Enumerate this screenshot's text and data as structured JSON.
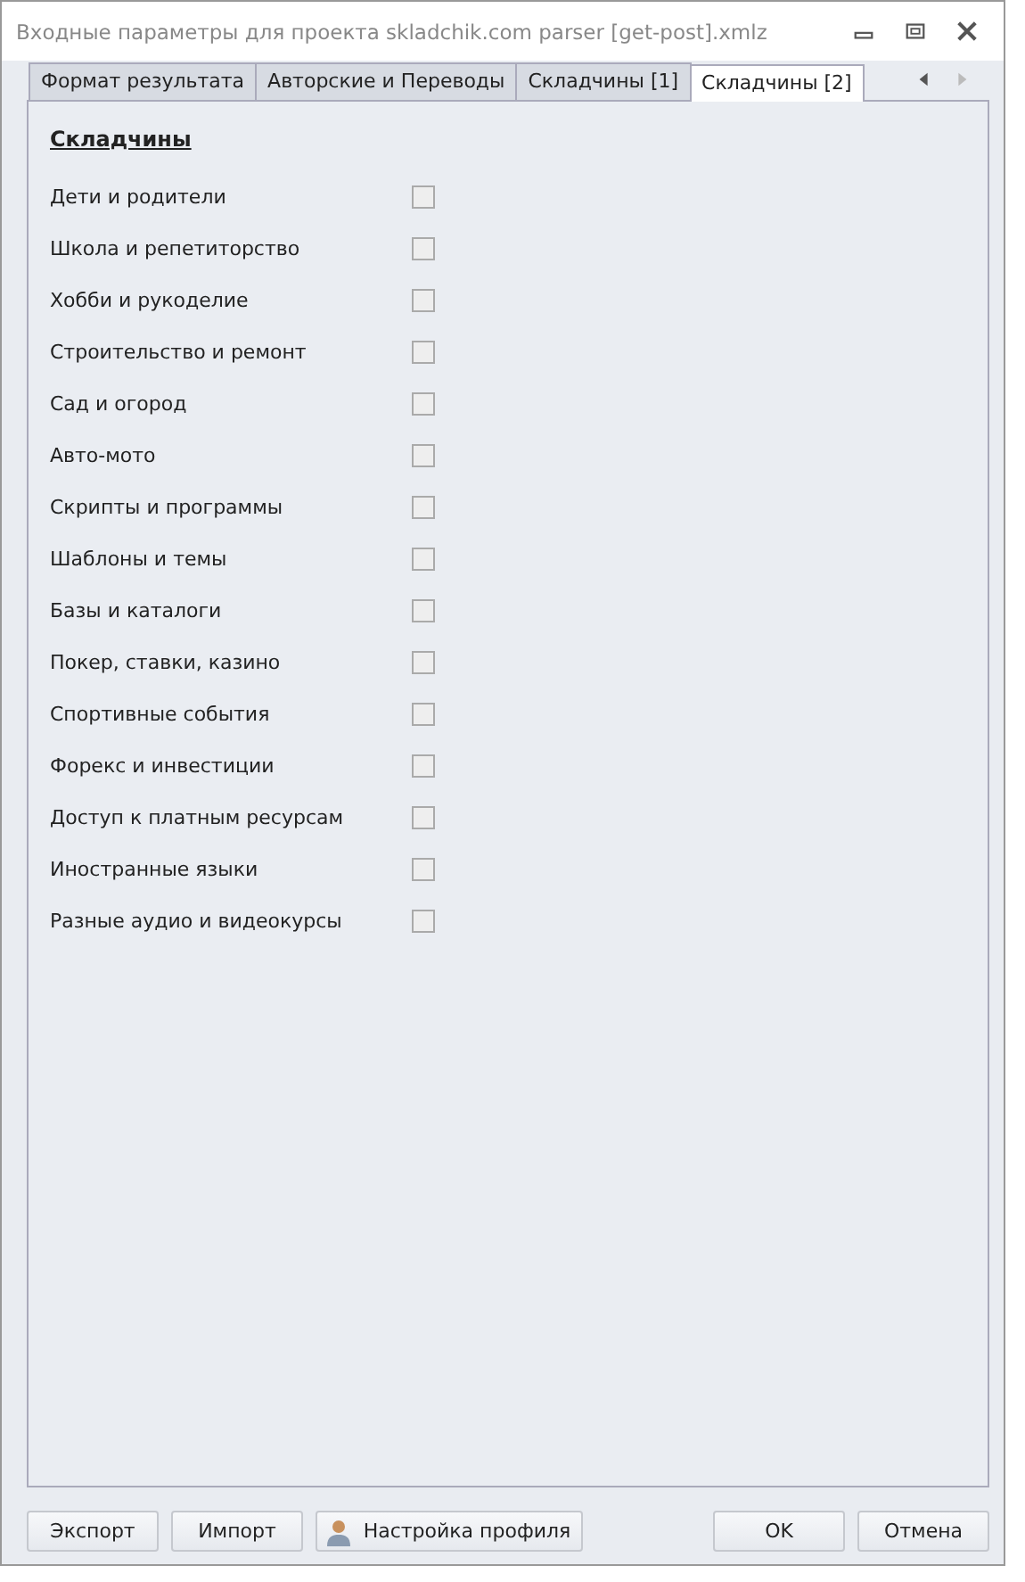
{
  "window": {
    "title": "Входные параметры для проекта skladchik.com parser [get-post].xmlz"
  },
  "tabs": [
    {
      "label": "Формат результата",
      "selected": false
    },
    {
      "label": "Авторские и Переводы",
      "selected": false
    },
    {
      "label": "Складчины [1]",
      "selected": false
    },
    {
      "label": "Складчины [2]",
      "selected": true
    }
  ],
  "section": {
    "title": "Складчины"
  },
  "options": [
    {
      "label": "Дети и родители",
      "checked": false
    },
    {
      "label": "Школа и репетиторство",
      "checked": false
    },
    {
      "label": "Хобби и рукоделие",
      "checked": false
    },
    {
      "label": "Строительство и ремонт",
      "checked": false
    },
    {
      "label": "Сад и огород",
      "checked": false
    },
    {
      "label": "Авто-мото",
      "checked": false
    },
    {
      "label": "Скрипты и программы",
      "checked": false
    },
    {
      "label": "Шаблоны и темы",
      "checked": false
    },
    {
      "label": "Базы и каталоги",
      "checked": false
    },
    {
      "label": "Покер, ставки, казино",
      "checked": false
    },
    {
      "label": "Спортивные события",
      "checked": false
    },
    {
      "label": "Форекс и инвестиции",
      "checked": false
    },
    {
      "label": "Доступ к платным ресурсам",
      "checked": false
    },
    {
      "label": "Иностранные языки",
      "checked": false
    },
    {
      "label": "Разные аудио и видеокурсы",
      "checked": false
    }
  ],
  "buttons": [
    {
      "label": "Экспорт",
      "kind": "plain"
    },
    {
      "label": "Импорт",
      "kind": "plain"
    },
    {
      "label": "Настройка профиля",
      "kind": "profile"
    },
    {
      "label": "OK",
      "kind": "plain"
    },
    {
      "label": "Отмена",
      "kind": "plain"
    }
  ]
}
